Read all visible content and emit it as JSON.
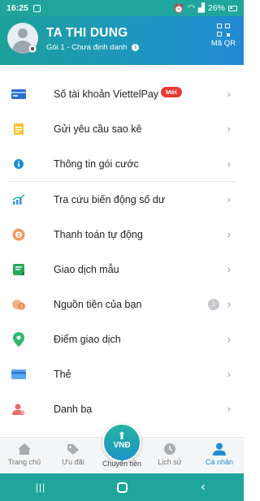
{
  "status_bar": {
    "time": "16:25",
    "battery": "26%"
  },
  "profile": {
    "name": "TA THI DUNG",
    "subtitle": "Gói 1 - Chưa định danh",
    "info_glyph": "i",
    "qr_label": "Mã QR"
  },
  "menu": [
    {
      "label": "Số tài khoản ViettelPay",
      "icon": "account-card-icon",
      "badge": "Mới"
    },
    {
      "label": "Gửi yêu cầu sao kê",
      "icon": "statement-request-icon"
    },
    {
      "label": "Thông tin gói cước",
      "icon": "info-icon"
    },
    {
      "label": "Tra cứu biến động số dư",
      "icon": "balance-chart-icon"
    },
    {
      "label": "Thanh toán tự động",
      "icon": "auto-payment-icon"
    },
    {
      "label": "Giao dịch mẫu",
      "icon": "template-transaction-icon"
    },
    {
      "label": "Nguồn tiền của bạn",
      "icon": "money-source-icon",
      "count": "1"
    },
    {
      "label": "Điểm giao dịch",
      "icon": "location-pin-icon"
    },
    {
      "label": "Thẻ",
      "icon": "card-icon"
    },
    {
      "label": "Danh bạ",
      "icon": "contacts-icon"
    }
  ],
  "bottom_nav": {
    "home": "Trang chủ",
    "promo": "Ưu đãi",
    "transfer": "Chuyển tiền",
    "transfer_currency": "VNĐ",
    "history": "Lịch sử",
    "profile": "Cá nhân"
  },
  "colors": {
    "brand_teal": "#1fa59c",
    "brand_blue": "#1e8ed2",
    "badge_red": "#e53935"
  }
}
